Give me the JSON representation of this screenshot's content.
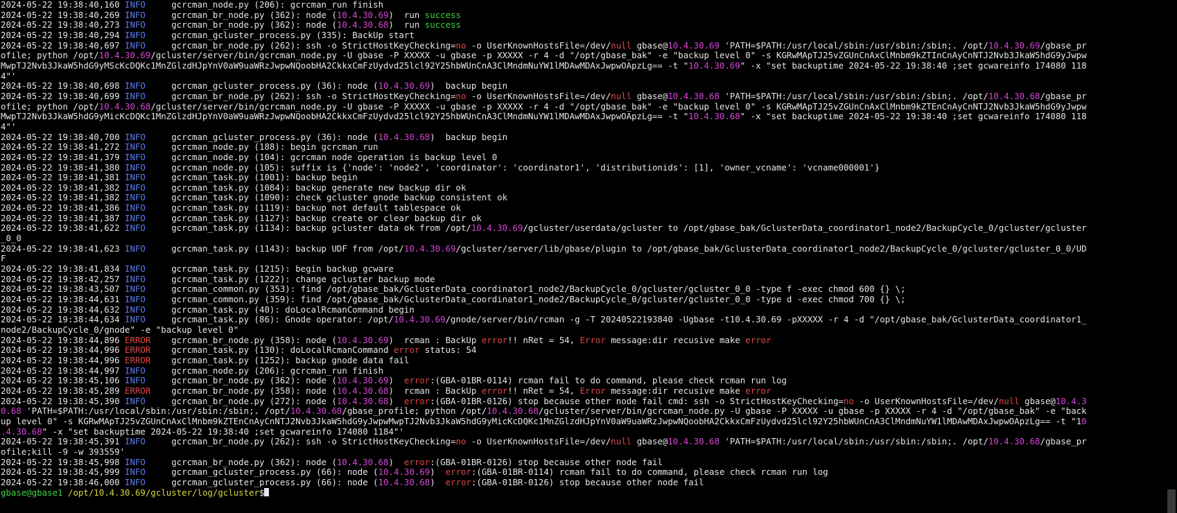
{
  "colors": {
    "g": "#3ed43e",
    "m": "#d646d6",
    "b": "#5c7cf0",
    "r": "#e24848",
    "y": "#d8d840",
    "fg": "#e6e6e6",
    "bg": "#000000"
  },
  "prompt": {
    "userhost": "gbase@gbase1",
    "cwd": "/opt/10.4.30.69/gcluster/log/gcluster",
    "symbol": "$"
  },
  "lines": [
    [
      [
        "2024-05-22 19:38:40,160 "
      ],
      [
        "INFO",
        "b"
      ],
      [
        "     gcrcman_node.py (206): gcrcman_run finish"
      ]
    ],
    [
      [
        "2024-05-22 19:38:40,269 "
      ],
      [
        "INFO",
        "b"
      ],
      [
        "     gcrcman_br_node.py (362): node ("
      ],
      [
        "10.4.30.69",
        "m"
      ],
      [
        ")  run "
      ],
      [
        "success",
        "g"
      ]
    ],
    [
      [
        "2024-05-22 19:38:40,273 "
      ],
      [
        "INFO",
        "b"
      ],
      [
        "     gcrcman_br_node.py (362): node ("
      ],
      [
        "10.4.30.68",
        "m"
      ],
      [
        ")  run "
      ],
      [
        "success",
        "g"
      ]
    ],
    [
      [
        "2024-05-22 19:38:40,294 "
      ],
      [
        "INFO",
        "b"
      ],
      [
        "     gcrcman_gcluster_process.py (335): BackUp start"
      ]
    ],
    [
      [
        "2024-05-22 19:38:40,697 "
      ],
      [
        "INFO",
        "b"
      ],
      [
        "     gcrcman_br_node.py (262): ssh -o StrictHostKeyChecking="
      ],
      [
        "no",
        "r"
      ],
      [
        " -o UserKnownHostsFile=/dev/"
      ],
      [
        "null",
        "r"
      ],
      [
        " gbase@"
      ],
      [
        "10.4.30.69",
        "m"
      ],
      [
        " 'PATH=$PATH:/usr/local/sbin:/usr/sbin:/sbin;. /opt/"
      ],
      [
        "10.4.30.69",
        "m"
      ],
      [
        "/gbase_pr"
      ]
    ],
    [
      [
        "ofile; python /opt/"
      ],
      [
        "10.4.30.69",
        "m"
      ],
      [
        "/gcluster/server/bin/gcrcman_node.py -U gbase -P XXXXX -u gbase -p XXXXX -r 4 -d \"/opt/gbase_bak\" -e \"backup level 0\" -s KGRwMApTJ25vZGUnCnAxClMnbm9kZTInCnAyCnNTJ2Nvb3JkaW5hdG9yJwpw"
      ]
    ],
    [
      [
        "MwpTJ2Nvb3JkaW5hdG9yMScKcDQKc1MnZGlzdHJpYnV0aW9uaWRzJwpwNQoobHA2CkkxCmFzUydvd25lcl92Y25hbWUnCnA3ClMndmNuYW1lMDAwMDAxJwpwOApzLg== -t \""
      ],
      [
        "10.4.30.69",
        "m"
      ],
      [
        "\" -x \"set backuptime 2024-05-22 19:38:40 ;set gcwareinfo 174080 118"
      ]
    ],
    [
      [
        "4\"'"
      ]
    ],
    [
      [
        "2024-05-22 19:38:40,698 "
      ],
      [
        "INFO",
        "b"
      ],
      [
        "     gcrcman_gcluster_process.py (36): node ("
      ],
      [
        "10.4.30.69",
        "m"
      ],
      [
        ")  backup begin"
      ]
    ],
    [
      [
        "2024-05-22 19:38:40,699 "
      ],
      [
        "INFO",
        "b"
      ],
      [
        "     gcrcman_br_node.py (262): ssh -o StrictHostKeyChecking="
      ],
      [
        "no",
        "r"
      ],
      [
        " -o UserKnownHostsFile=/dev/"
      ],
      [
        "null",
        "r"
      ],
      [
        " gbase@"
      ],
      [
        "10.4.30.68",
        "m"
      ],
      [
        " 'PATH=$PATH:/usr/local/sbin:/usr/sbin:/sbin;. /opt/"
      ],
      [
        "10.4.30.68",
        "m"
      ],
      [
        "/gbase_pr"
      ]
    ],
    [
      [
        "ofile; python /opt/"
      ],
      [
        "10.4.30.68",
        "m"
      ],
      [
        "/gcluster/server/bin/gcrcman_node.py -U gbase -P XXXXX -u gbase -p XXXXX -r 4 -d \"/opt/gbase_bak\" -e \"backup level 0\" -s KGRwMApTJ25vZGUnCnAxClMnbm9kZTEnCnAyCnNTJ2Nvb3JkaW5hdG9yJwpw"
      ]
    ],
    [
      [
        "MwpTJ2Nvb3JkaW5hdG9yMicKcDQKc1MnZGlzdHJpYnV0aW9uaWRzJwpwNQoobHA2CkkxCmFzUydvd25lcl92Y25hbWUnCnA3ClMndmNuYW1lMDAwMDAxJwpwOApzLg== -t \""
      ],
      [
        "10.4.30.68",
        "m"
      ],
      [
        "\" -x \"set backuptime 2024-05-22 19:38:40 ;set gcwareinfo 174080 118"
      ]
    ],
    [
      [
        "4\"'"
      ]
    ],
    [
      [
        "2024-05-22 19:38:40,700 "
      ],
      [
        "INFO",
        "b"
      ],
      [
        "     gcrcman_gcluster_process.py (36): node ("
      ],
      [
        "10.4.30.68",
        "m"
      ],
      [
        ")  backup begin"
      ]
    ],
    [
      [
        "2024-05-22 19:38:41,272 "
      ],
      [
        "INFO",
        "b"
      ],
      [
        "     gcrcman_node.py (188): begin gcrcman_run"
      ]
    ],
    [
      [
        "2024-05-22 19:38:41,379 "
      ],
      [
        "INFO",
        "b"
      ],
      [
        "     gcrcman_node.py (104): gcrcman node operation is backup level 0"
      ]
    ],
    [
      [
        "2024-05-22 19:38:41,380 "
      ],
      [
        "INFO",
        "b"
      ],
      [
        "     gcrcman_node.py (105): suffix is {'node': 'node2', 'coordinator': 'coordinator1', 'distributionids': [1], 'owner_vcname': 'vcname000001'}"
      ]
    ],
    [
      [
        "2024-05-22 19:38:41,381 "
      ],
      [
        "INFO",
        "b"
      ],
      [
        "     gcrcman_task.py (1001): backup begin"
      ]
    ],
    [
      [
        "2024-05-22 19:38:41,382 "
      ],
      [
        "INFO",
        "b"
      ],
      [
        "     gcrcman_task.py (1084): backup generate new backup dir ok"
      ]
    ],
    [
      [
        "2024-05-22 19:38:41,382 "
      ],
      [
        "INFO",
        "b"
      ],
      [
        "     gcrcman_task.py (1090): check gcluster gnode backup consistent ok"
      ]
    ],
    [
      [
        "2024-05-22 19:38:41,386 "
      ],
      [
        "INFO",
        "b"
      ],
      [
        "     gcrcman_task.py (1119): backup not default tablespace ok"
      ]
    ],
    [
      [
        "2024-05-22 19:38:41,387 "
      ],
      [
        "INFO",
        "b"
      ],
      [
        "     gcrcman_task.py (1127): backup create or clear backup dir ok"
      ]
    ],
    [
      [
        "2024-05-22 19:38:41,622 "
      ],
      [
        "INFO",
        "b"
      ],
      [
        "     gcrcman_task.py (1134): backup gcluster data ok from /opt/"
      ],
      [
        "10.4.30.69",
        "m"
      ],
      [
        "/gcluster/userdata/gcluster to /opt/gbase_bak/GclusterData_coordinator1_node2/BackupCycle_0/gcluster/gcluster"
      ]
    ],
    [
      [
        "_0_0"
      ]
    ],
    [
      [
        "2024-05-22 19:38:41,623 "
      ],
      [
        "INFO",
        "b"
      ],
      [
        "     gcrcman_task.py (1143): backup UDF from /opt/"
      ],
      [
        "10.4.30.69",
        "m"
      ],
      [
        "/gcluster/server/lib/gbase/plugin to /opt/gbase_bak/GclusterData_coordinator1_node2/BackupCycle_0/gcluster/gcluster_0_0/UD"
      ]
    ],
    [
      [
        "F"
      ]
    ],
    [
      [
        "2024-05-22 19:38:41,834 "
      ],
      [
        "INFO",
        "b"
      ],
      [
        "     gcrcman_task.py (1215): begin backup gcware"
      ]
    ],
    [
      [
        "2024-05-22 19:38:42,257 "
      ],
      [
        "INFO",
        "b"
      ],
      [
        "     gcrcman_task.py (1222): change gcluster backup mode"
      ]
    ],
    [
      [
        "2024-05-22 19:38:43,507 "
      ],
      [
        "INFO",
        "b"
      ],
      [
        "     gcrcman_common.py (353): find /opt/gbase_bak/GclusterData_coordinator1_node2/BackupCycle_0/gcluster/gcluster_0_0 -type f -exec chmod 600 {} \\;"
      ]
    ],
    [
      [
        "2024-05-22 19:38:44,631 "
      ],
      [
        "INFO",
        "b"
      ],
      [
        "     gcrcman_common.py (359): find /opt/gbase_bak/GclusterData_coordinator1_node2/BackupCycle_0/gcluster/gcluster_0_0 -type d -exec chmod 700 {} \\;"
      ]
    ],
    [
      [
        "2024-05-22 19:38:44,632 "
      ],
      [
        "INFO",
        "b"
      ],
      [
        "     gcrcman_task.py (40): doLocalRcmanCommand begin"
      ]
    ],
    [
      [
        "2024-05-22 19:38:44,634 "
      ],
      [
        "INFO",
        "b"
      ],
      [
        "     gcrcman_task.py (86): Gnode operator: /opt/"
      ],
      [
        "10.4.30.69",
        "m"
      ],
      [
        "/gnode/server/bin/rcman -g -T 20240522193840 -Ugbase -t10.4.30.69 -pXXXXX -r 4 -d \"/opt/gbase_bak/GclusterData_coordinator1_"
      ]
    ],
    [
      [
        "node2/BackupCycle_0/gnode\" -e \"backup level 0\""
      ]
    ],
    [
      [
        "2024-05-22 19:38:44,896 "
      ],
      [
        "ERROR",
        "r"
      ],
      [
        "    gcrcman_br_node.py (358): node ("
      ],
      [
        "10.4.30.69",
        "m"
      ],
      [
        ")  rcman : BackUp "
      ],
      [
        "error",
        "r"
      ],
      [
        "!! nRet = 54, "
      ],
      [
        "Error",
        "r"
      ],
      [
        " message:dir recusive make "
      ],
      [
        "error",
        "r"
      ]
    ],
    [
      [
        "2024-05-22 19:38:44,996 "
      ],
      [
        "ERROR",
        "r"
      ],
      [
        "    gcrcman_task.py (130): doLocalRcmanCommand "
      ],
      [
        "error",
        "r"
      ],
      [
        " status: 54"
      ]
    ],
    [
      [
        "2024-05-22 19:38:44,996 "
      ],
      [
        "ERROR",
        "r"
      ],
      [
        "    gcrcman_task.py (1252): backup gnode data fail"
      ]
    ],
    [
      [
        "2024-05-22 19:38:44,997 "
      ],
      [
        "INFO",
        "b"
      ],
      [
        "     gcrcman_node.py (206): gcrcman_run finish"
      ]
    ],
    [
      [
        "2024-05-22 19:38:45,106 "
      ],
      [
        "INFO",
        "b"
      ],
      [
        "     gcrcman_br_node.py (362): node ("
      ],
      [
        "10.4.30.69",
        "m"
      ],
      [
        ")  "
      ],
      [
        "error",
        "r"
      ],
      [
        ":(GBA-01BR-0114) rcman fail to do command, please check rcman run log"
      ]
    ],
    [
      [
        "2024-05-22 19:38:45,289 "
      ],
      [
        "ERROR",
        "r"
      ],
      [
        "    gcrcman_br_node.py (358): node ("
      ],
      [
        "10.4.30.68",
        "m"
      ],
      [
        ")  rcman : BackUp "
      ],
      [
        "error",
        "r"
      ],
      [
        "!! nRet = 54, "
      ],
      [
        "Error",
        "r"
      ],
      [
        " message:dir recusive make "
      ],
      [
        "error",
        "r"
      ]
    ],
    [
      [
        "2024-05-22 19:38:45,390 "
      ],
      [
        "INFO",
        "b"
      ],
      [
        "     gcrcman_br_node.py (272): node ("
      ],
      [
        "10.4.30.68",
        "m"
      ],
      [
        ")  "
      ],
      [
        "error",
        "r"
      ],
      [
        ":(GBA-01BR-0126) stop because other node fail cmd: ssh -o StrictHostKeyChecking="
      ],
      [
        "no",
        "r"
      ],
      [
        " -o UserKnownHostsFile=/dev/"
      ],
      [
        "null",
        "r"
      ],
      [
        " gbase@"
      ],
      [
        "10.4.3",
        "m"
      ]
    ],
    [
      [
        "0.68",
        "m"
      ],
      [
        " 'PATH=$PATH:/usr/local/sbin:/usr/sbin:/sbin;. /opt/"
      ],
      [
        "10.4.30.68",
        "m"
      ],
      [
        "/gbase_profile; python /opt/"
      ],
      [
        "10.4.30.68",
        "m"
      ],
      [
        "/gcluster/server/bin/gcrcman_node.py -U gbase -P XXXXX -u gbase -p XXXXX -r 4 -d \"/opt/gbase_bak\" -e \"back"
      ]
    ],
    [
      [
        "up level 0\" -s KGRwMApTJ25vZGUnCnAxClMnbm9kZTEnCnAyCnNTJ2Nvb3JkaW5hdG9yJwpwMwpTJ2Nvb3JkaW5hdG9yMicKcDQKc1MnZGlzdHJpYnV0aW9uaWRzJwpwNQoobHA2CkkxCmFzUydvd25lcl92Y25hbWUnCnA3ClMndmNuYW1lMDAwMDAxJwpwOApzLg== -t \"1"
      ],
      [
        "0",
        "m"
      ]
    ],
    [
      [
        ".4.30.68",
        "m"
      ],
      [
        "\" -x \"set backuptime 2024-05-22 19:38:40 ;set gcwareinfo 174080 1184\"'"
      ]
    ],
    [
      [
        "2024-05-22 19:38:45,391 "
      ],
      [
        "INFO",
        "b"
      ],
      [
        "     gcrcman_br_node.py (262): ssh -o StrictHostKeyChecking="
      ],
      [
        "no",
        "r"
      ],
      [
        " -o UserKnownHostsFile=/dev/"
      ],
      [
        "null",
        "r"
      ],
      [
        " gbase@"
      ],
      [
        "10.4.30.68",
        "m"
      ],
      [
        " 'PATH=$PATH:/usr/local/sbin:/usr/sbin:/sbin;. /opt/"
      ],
      [
        "10.4.30.68",
        "m"
      ],
      [
        "/gbase_pr"
      ]
    ],
    [
      [
        "ofile;kill -9 -w 393559'"
      ]
    ],
    [
      [
        "2024-05-22 19:38:45,998 "
      ],
      [
        "INFO",
        "b"
      ],
      [
        "     gcrcman_br_node.py (362): node ("
      ],
      [
        "10.4.30.68",
        "m"
      ],
      [
        ")  "
      ],
      [
        "error",
        "r"
      ],
      [
        ":(GBA-01BR-0126) stop because other node fail"
      ]
    ],
    [
      [
        "2024-05-22 19:38:45,999 "
      ],
      [
        "INFO",
        "b"
      ],
      [
        "     gcrcman_gcluster_process.py (66): node ("
      ],
      [
        "10.4.30.69",
        "m"
      ],
      [
        ")  "
      ],
      [
        "error",
        "r"
      ],
      [
        ":(GBA-01BR-0114) rcman fail to do command, please check rcman run log"
      ]
    ],
    [
      [
        "2024-05-22 19:38:46,000 "
      ],
      [
        "INFO",
        "b"
      ],
      [
        "     gcrcman_gcluster_process.py (66): node ("
      ],
      [
        "10.4.30.68",
        "m"
      ],
      [
        ")  "
      ],
      [
        "error",
        "r"
      ],
      [
        ":(GBA-01BR-0126) stop because other node fail"
      ]
    ]
  ]
}
